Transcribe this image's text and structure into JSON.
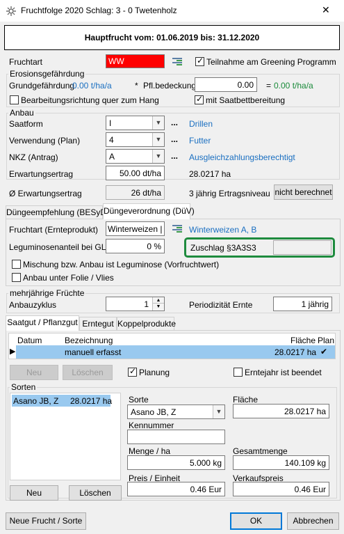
{
  "window": {
    "title": "Fruchtfolge 2020 Schlag: 3 - 0 Twetenholz",
    "close": "✕"
  },
  "header": {
    "text": "Hauptfrucht vom: 01.06.2019 bis: 31.12.2020"
  },
  "fruchtart": {
    "label": "Fruchtart",
    "value": "WW",
    "value_bg": "#ff0000",
    "greening_label": "Teilnahme am Greening Programm",
    "greening_checked": true
  },
  "erosion": {
    "group": "Erosionsgefährdung",
    "grund_label": "Grundgefährdung",
    "grund_value": "0.00 t/ha/a",
    "pfl_marker": "*",
    "pfl_label": "Pfl.bedeckung",
    "pfl_value": "0.00",
    "eq": "=",
    "result": "0.00 t/ha/a",
    "quer_label": "Bearbeitungsrichtung quer zum Hang",
    "quer_checked": false,
    "saatbett_label": "mit Saatbettbereitung",
    "saatbett_checked": true
  },
  "anbau": {
    "group": "Anbau",
    "saatform_label": "Saatform",
    "saatform_value": "I",
    "saatform_text": "Drillen",
    "verwendung_label": "Verwendung (Plan)",
    "verwendung_value": "4",
    "verwendung_text": "Futter",
    "nkz_label": "NKZ  (Antrag)",
    "nkz_value": "A",
    "nkz_text": "Ausgleichzahlungsberechtigt",
    "dots": "...",
    "ertrag_label": "Erwartungsertrag",
    "ertrag_value": "50.00 dt/ha",
    "ertrag_area": "28.0217 ha"
  },
  "avg": {
    "label": "Ø Erwartungsertrag",
    "value": "26 dt/ha",
    "niveau_label": "3 jährig Ertragsniveau",
    "niveau_button": "nicht berechnet"
  },
  "dunge_tabs": [
    {
      "label": "Düngeempfehlung (BESyD)"
    },
    {
      "label": "Düngeverordnung (DüV)"
    }
  ],
  "duv": {
    "frucht_label": "Fruchtart (Ernteprodukt)",
    "frucht_value": "Winterweizen | V",
    "frucht_text": "Winterweizen A, B",
    "legum_label": "Leguminosenanteil bei GL",
    "legum_value": "0 %",
    "zuschlag_label": "Zuschlag §3A3S3",
    "zuschlag_value": "",
    "mischung_label": "Mischung bzw. Anbau ist Leguminose (Vorfruchtwert)",
    "mischung_checked": false,
    "folie_label": "Anbau unter Folie / Vlies",
    "folie_checked": false,
    "highlight_color": "#1e8b3e"
  },
  "mehrj": {
    "group": "mehrjährige Früchte",
    "zyklus_label": "Anbauzyklus",
    "zyklus_value": "1",
    "perio_label": "Periodizität Ernte",
    "perio_value": "1 jährig"
  },
  "saat_tabs": [
    {
      "label": "Saatgut / Pflanzgut"
    },
    {
      "label": "Erntegut"
    },
    {
      "label": "Koppelprodukte"
    }
  ],
  "grid": {
    "columns": {
      "datum": "Datum",
      "bezeichnung": "Bezeichnung",
      "flaeche": "Fläche",
      "plan": "Plan"
    },
    "rows": [
      {
        "marker": "▶",
        "datum": "",
        "bezeichnung": "manuell erfasst",
        "flaeche": "28.0217 ha",
        "plan": "✔"
      }
    ],
    "selected_color": "#99c9ef"
  },
  "grid_buttons": {
    "neu": "Neu",
    "loeschen": "Löschen"
  },
  "planung": {
    "label": "Planung",
    "checked": true
  },
  "erntejahr": {
    "label": "Erntejahr ist beendet",
    "checked": false
  },
  "sorten": {
    "group": "Sorten",
    "list": [
      {
        "name": "Asano JB, Z",
        "area": "28.0217 ha"
      }
    ],
    "sorte_label": "Sorte",
    "sorte_value": "Asano JB, Z",
    "flaeche_label": "Fläche",
    "flaeche_value": "28.0217 ha",
    "kennummer_label": "Kennummer",
    "kennummer_value": "",
    "menge_label": "Menge / ha",
    "menge_value": "5.000 kg",
    "gesamt_label": "Gesamtmenge",
    "gesamt_value": "140.109 kg",
    "preis_label": "Preis / Einheit",
    "preis_value": "0.46 Eur",
    "verkauf_label": "Verkaufspreis",
    "verkauf_value": "0.46 Eur",
    "neu": "Neu",
    "loeschen": "Löschen"
  },
  "footer": {
    "neue_frucht": "Neue Frucht / Sorte",
    "ok": "OK",
    "abbrechen": "Abbrechen"
  }
}
